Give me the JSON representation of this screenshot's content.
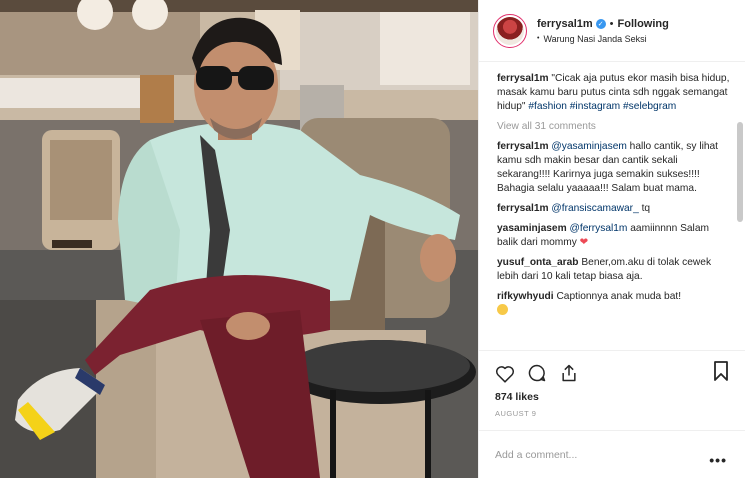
{
  "post": {
    "username": "ferrysal1m",
    "verified_glyph": "✓",
    "separator": "•",
    "follow_label": "Following",
    "location": "Warung Nasi Janda Seksi"
  },
  "caption": {
    "user": "ferrysal1m",
    "text": "\"Cicak aja putus ekor masih bisa hidup, masak kamu baru putus cinta sdh nggak semangat hidup\"",
    "tags": [
      "#fashion",
      "#instagram",
      "#selebgram"
    ]
  },
  "view_all_label": "View all 31 comments",
  "comments": [
    {
      "user": "ferrysal1m",
      "mention": "@yasaminjasem",
      "text": " hallo cantik, sy lihat kamu sdh makin besar dan cantik sekali sekarang!!!! Karirnya juga semakin sukses!!!! Bahagia selalu yaaaaa!!! Salam buat mama."
    },
    {
      "user": "ferrysal1m",
      "mention": "@fransiscamawar_",
      "text": " tq"
    },
    {
      "user": "yasaminjasem",
      "mention": "@ferrysal1m",
      "text": " aamiinnnn Salam balik dari mommy "
    },
    {
      "user": "yusuf_onta_arab",
      "mention": "",
      "text": " Bener,om.aku di tolak cewek lebih dari 10 kali tetap biasa aja."
    },
    {
      "user": "rifkywhyudi",
      "mention": "",
      "text": " Captionnya anak muda bat!"
    }
  ],
  "icons": {
    "heart": "heart-icon",
    "comment": "comment-icon",
    "share": "share-icon",
    "bookmark": "bookmark-icon",
    "heart_glyph": "❤"
  },
  "likes_label": "874 likes",
  "date_label": "AUGUST 9",
  "add_comment_placeholder": "Add a comment...",
  "more_label": "•••",
  "colors": {
    "link": "#003569",
    "verified": "#3897f0",
    "heart": "#ed4956",
    "muted": "#999999"
  }
}
